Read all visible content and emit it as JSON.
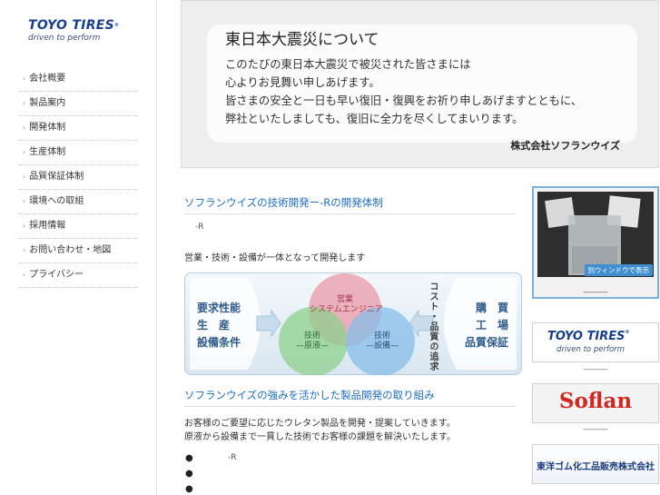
{
  "sidebar": {
    "logo": {
      "brand": "TOYO TIRES",
      "tagline": "driven to perform"
    },
    "items": [
      {
        "label": "会社概要"
      },
      {
        "label": "製品案内"
      },
      {
        "label": "開発体制"
      },
      {
        "label": "生産体制"
      },
      {
        "label": "品質保証体制"
      },
      {
        "label": "環境への取組"
      },
      {
        "label": "採用情報"
      },
      {
        "label": "お問い合わせ・地図"
      },
      {
        "label": "プライバシー"
      }
    ]
  },
  "banner": {
    "title": "東日本大震災について",
    "lines": [
      "このたびの東日本大震災で被災された皆さまには",
      "心よりお見舞い申しあげます。",
      "皆さまの安全と一日も早い復旧・復興をお祈り申しあげますとともに、",
      "弊社といたしましても、復旧に全力を尽くしてまいります。"
    ],
    "company": "株式会社ソフランウイズ"
  },
  "main": {
    "section1_title": "ソフランウイズの技術開発ー-Rの開発体制",
    "section1_small": "-R",
    "section1_text": "営業・技術・設備が一体となって開発します",
    "diagram": {
      "left_lines": [
        "要求性能",
        "生　産",
        "設備条件"
      ],
      "right_lines": [
        "購　買",
        "工　場",
        "品質保証"
      ],
      "vertical_text": "コスト・品質の追求",
      "circle_top": [
        "営業",
        "システムエンジニア"
      ],
      "circle_left": [
        "技術",
        "—原液—"
      ],
      "circle_right": [
        "技術",
        "—設備—"
      ]
    },
    "section2_title": "ソフランウイズの強みを活かした製品開発の取り組み",
    "section2_lines": [
      "お客様のご要望に応じたウレタン製品を開発・提案していきます。",
      "原液から設備まで一貫した技術でお客様の課題を解決いたします。"
    ],
    "bullets": [
      {
        "symbol": "●",
        "text": "-R"
      },
      {
        "symbol": "●",
        "text": ""
      },
      {
        "symbol": "●",
        "text": ""
      }
    ]
  },
  "right": {
    "video_button": "別ウィンドウで表示",
    "video_caption": "―――",
    "banners": [
      {
        "brand": "TOYO TIRES",
        "tagline": "driven to perform",
        "caption": "―――"
      },
      {
        "brand": "Soflan",
        "caption": "―――"
      },
      {
        "brand": "東洋ゴム化工品販売株式会社",
        "caption": ""
      }
    ]
  },
  "colors": {
    "link_blue": "#1e6fc4",
    "brand_navy": "#1a3f8f",
    "soflan_red": "#d3261e",
    "video_border": "#7db0d8"
  },
  "icons": [
    "arrow-right-icon",
    "bullet-icon"
  ]
}
